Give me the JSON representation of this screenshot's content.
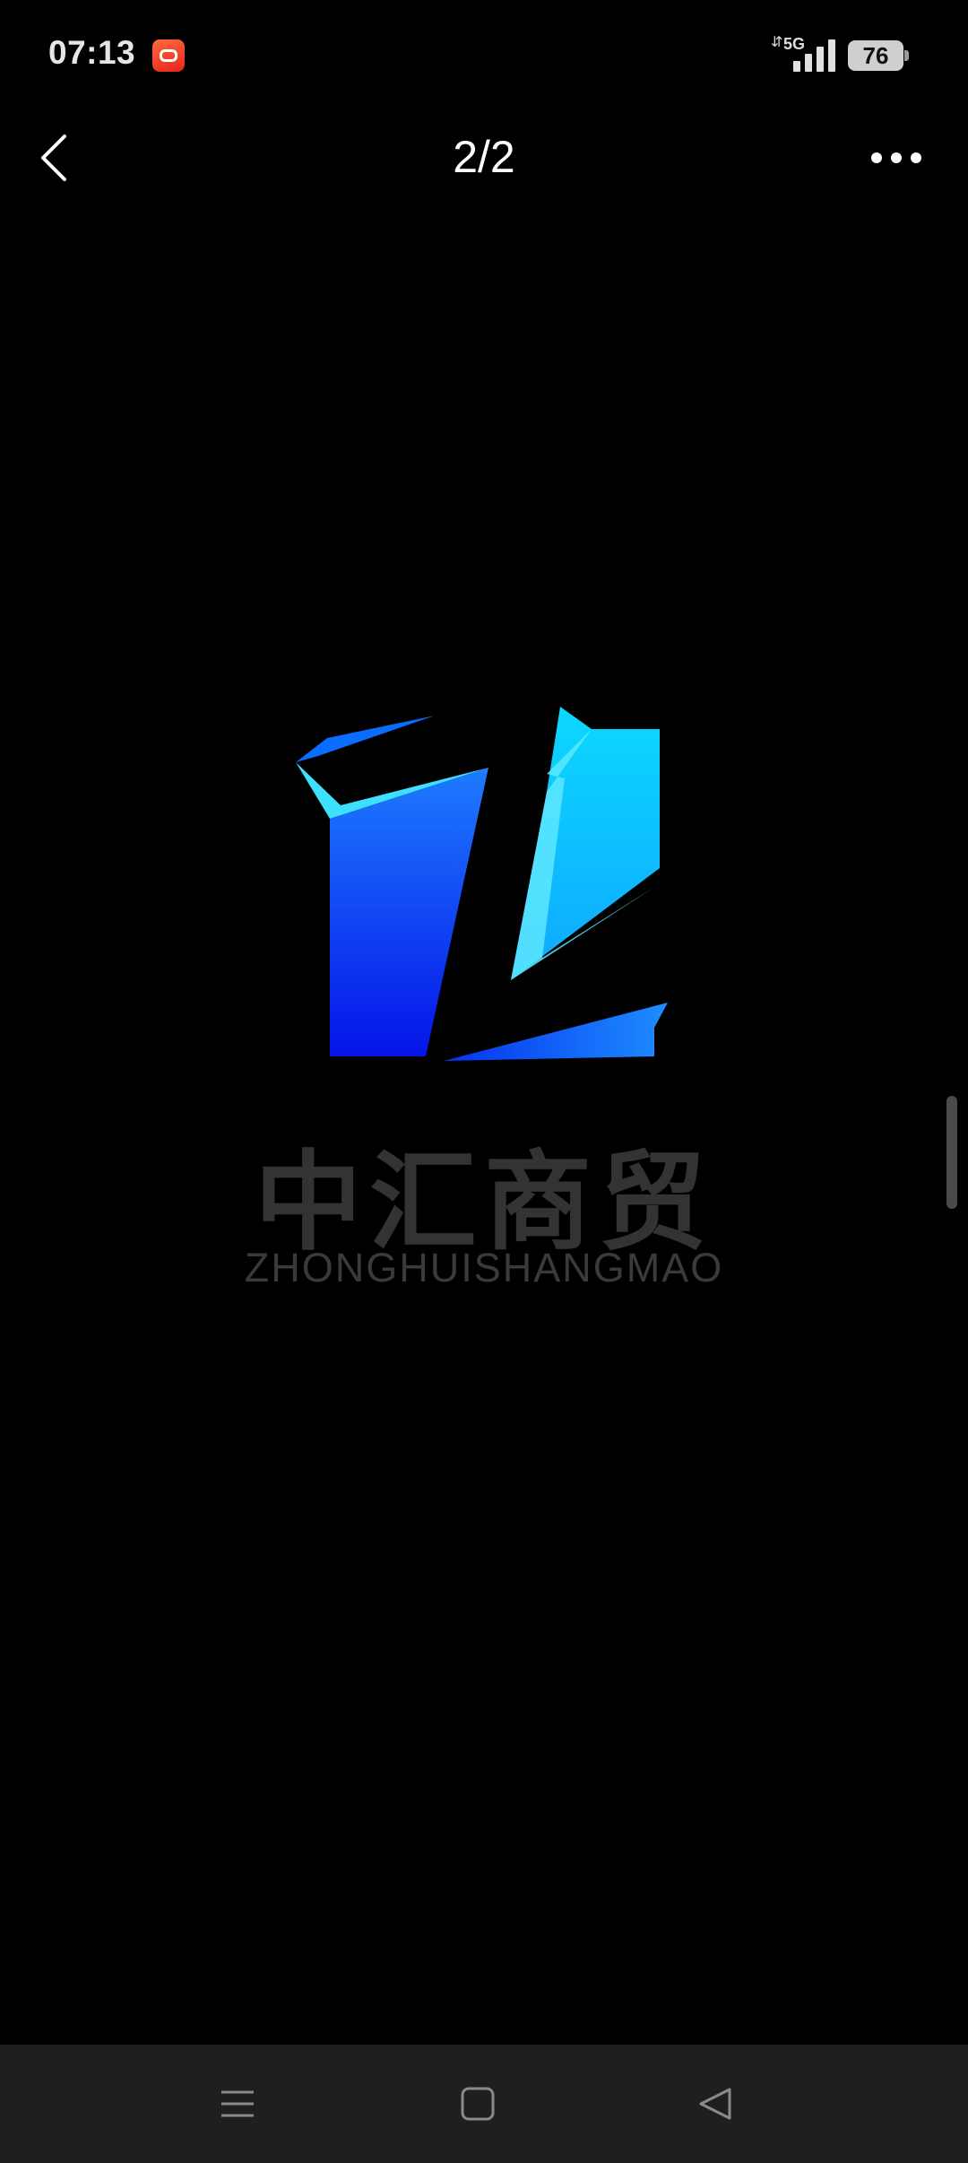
{
  "status_bar": {
    "time": "07:13",
    "network": "5G",
    "battery": "76",
    "app_icon": "red-app-icon"
  },
  "header": {
    "back_icon": "chevron-left-icon",
    "page_counter": "2/2",
    "more_icon": "more-dots-icon"
  },
  "image": {
    "brand_chinese": "中汇商贸",
    "brand_english": "ZHONGHUISHANGMAO",
    "colors": {
      "logo_light": "#12dcff",
      "logo_dark": "#0a1be8",
      "text_gray": "#333333"
    }
  },
  "nav_bar": {
    "menu_icon": "menu-icon",
    "home_icon": "home-icon",
    "back_icon": "back-triangle-icon"
  }
}
